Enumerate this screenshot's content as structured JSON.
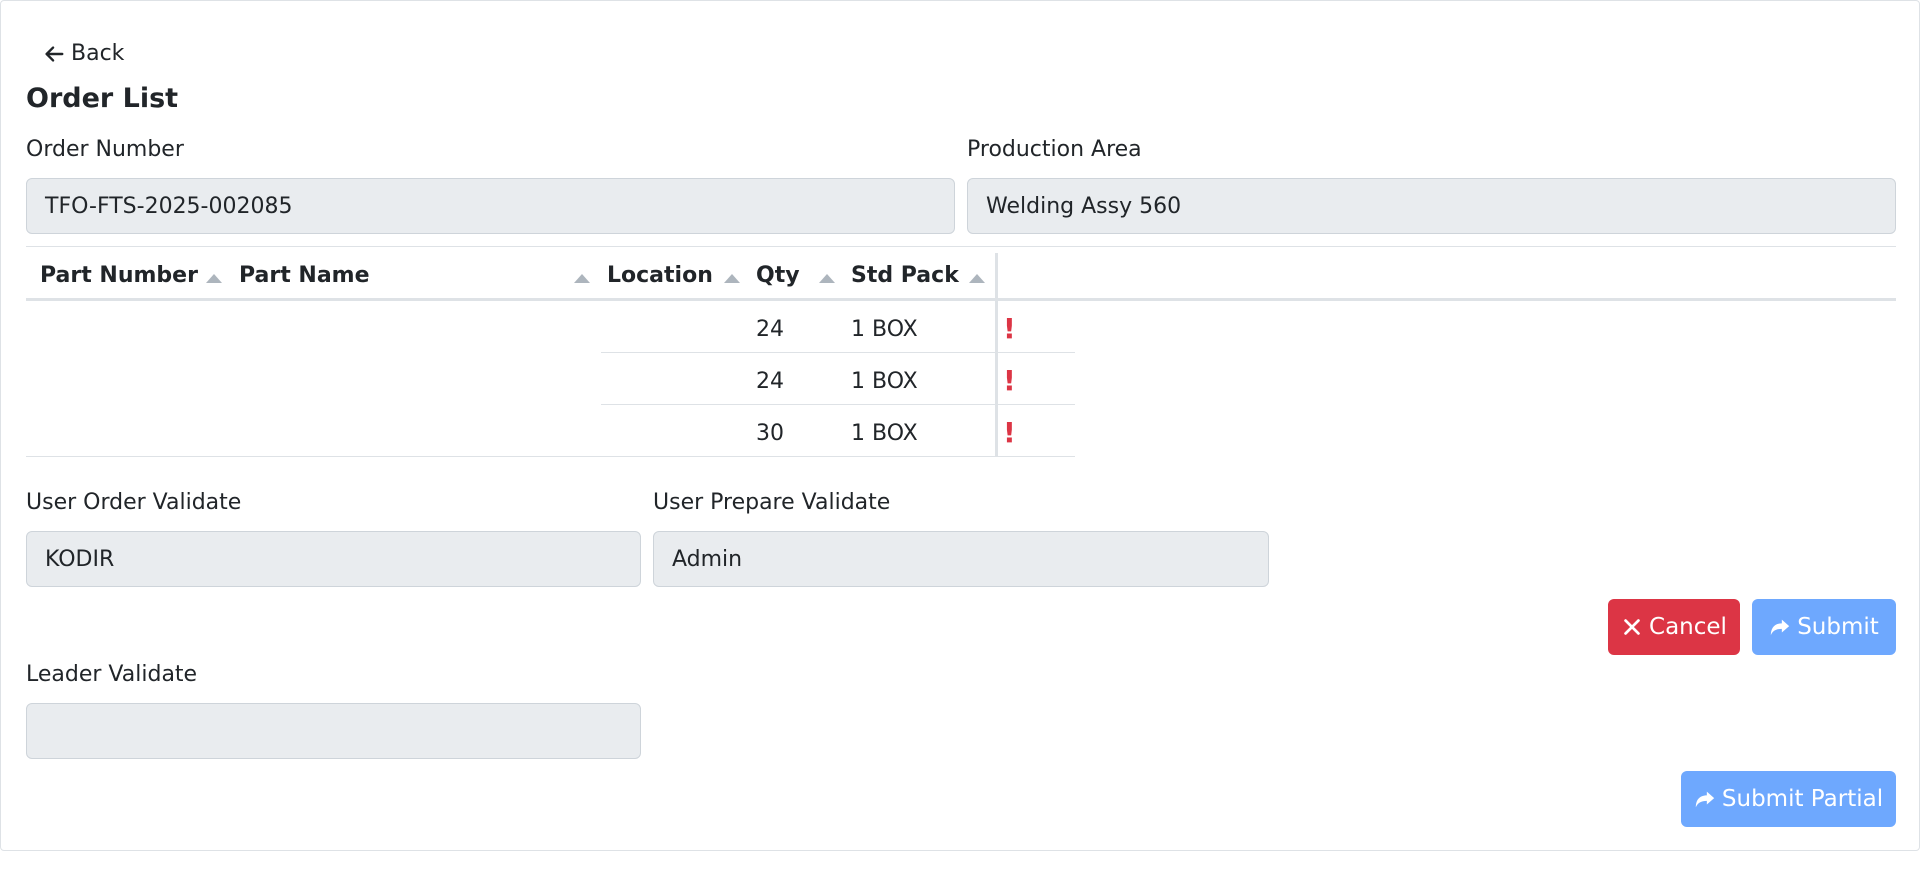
{
  "nav": {
    "back_label": "Back"
  },
  "page": {
    "title": "Order List"
  },
  "order": {
    "number_label": "Order Number",
    "number_value": "TFO-FTS-2025-002085",
    "area_label": "Production Area",
    "area_value": "Welding Assy 560"
  },
  "table": {
    "columns": [
      "Part Number",
      "Part Name",
      "Location",
      "Qty",
      "Std Pack"
    ],
    "rows": [
      {
        "part_number": "",
        "part_name": "",
        "location": "",
        "qty": "24",
        "std_pack": "1 BOX",
        "flag": "!"
      },
      {
        "part_number": "",
        "part_name": "",
        "location": "",
        "qty": "24",
        "std_pack": "1 BOX",
        "flag": "!"
      },
      {
        "part_number": "",
        "part_name": "",
        "location": "",
        "qty": "30",
        "std_pack": "1 BOX",
        "flag": "!"
      }
    ]
  },
  "validation": {
    "user_order_label": "User Order Validate",
    "user_order_value": "KODIR",
    "user_prepare_label": "User Prepare Validate",
    "user_prepare_value": "Admin",
    "leader_label": "Leader Validate",
    "leader_value": ""
  },
  "actions": {
    "cancel_label": "Cancel",
    "submit_label": "Submit",
    "submit_partial_label": "Submit Partial"
  },
  "colors": {
    "danger": "#dc3545",
    "primary_disabled": "#6ea8fe",
    "field_bg": "#e9ecef"
  }
}
